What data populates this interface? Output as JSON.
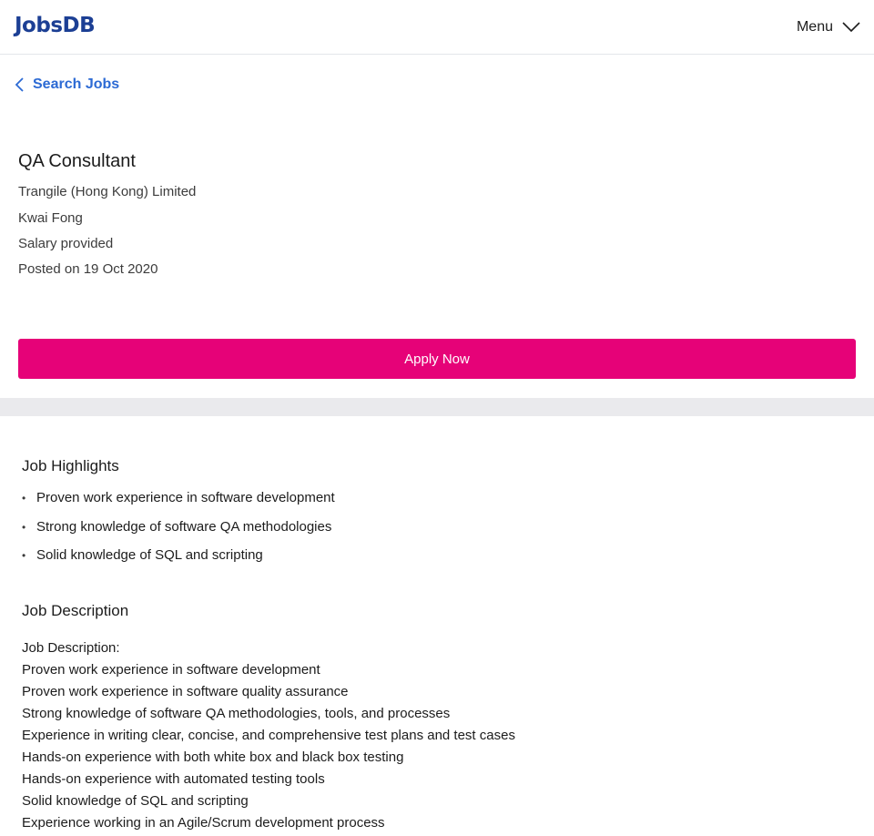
{
  "header": {
    "logo_text": "JobsDB",
    "menu_label": "Menu"
  },
  "nav": {
    "back_label": "Search Jobs"
  },
  "job": {
    "title": "QA Consultant",
    "company": "Trangile (Hong Kong) Limited",
    "location": "Kwai Fong",
    "salary": "Salary provided",
    "posted": "Posted on 19 Oct 2020"
  },
  "apply": {
    "label": "Apply Now"
  },
  "highlights": {
    "title": "Job Highlights",
    "items": [
      "Proven work experience in software development",
      "Strong knowledge of software QA methodologies",
      "Solid knowledge of SQL and scripting"
    ]
  },
  "description": {
    "title": "Job Description",
    "lines": [
      "Job Description:",
      "Proven work experience in software development",
      "Proven work experience in software quality assurance",
      "Strong knowledge of software QA methodologies, tools, and processes",
      "Experience in writing clear, concise, and comprehensive test plans and test cases",
      "Hands-on experience with both white box and black box testing",
      "Hands-on experience with automated testing tools",
      "Solid knowledge of SQL and scripting",
      "Experience working in an Agile/Scrum development process"
    ]
  },
  "colors": {
    "brand": "#1c3f94",
    "link": "#2c6ad4",
    "apply": "#e60278",
    "band": "#eaeaed"
  },
  "icons": {
    "menu": "chevron-down-icon",
    "back": "chevron-left-icon"
  }
}
